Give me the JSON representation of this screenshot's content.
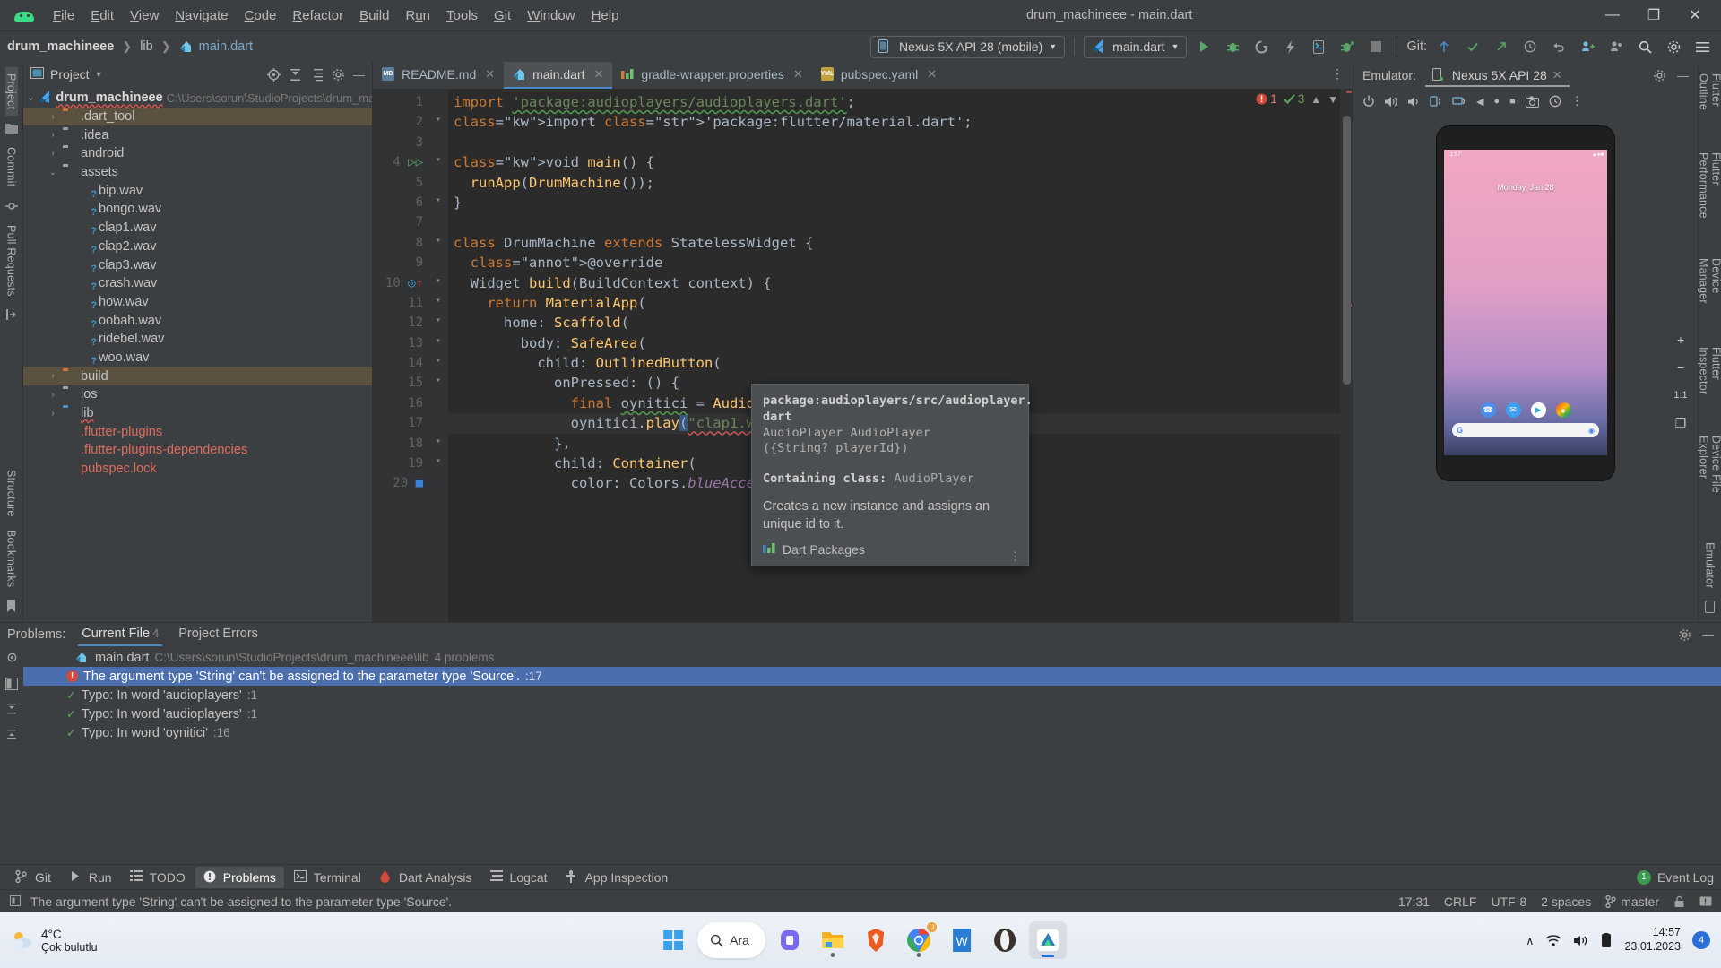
{
  "window": {
    "title": "drum_machineee - main.dart"
  },
  "menu": {
    "items": [
      "File",
      "Edit",
      "View",
      "Navigate",
      "Code",
      "Refactor",
      "Build",
      "Run",
      "Tools",
      "Git",
      "Window",
      "Help"
    ]
  },
  "window_controls": {
    "minimize": "—",
    "maximize": "❐",
    "close": "✕"
  },
  "breadcrumb": {
    "project": "drum_machineee",
    "folder": "lib",
    "file": "main.dart"
  },
  "toolbar": {
    "device_selector": "Nexus 5X API 28 (mobile)",
    "run_config": "main.dart",
    "git_label": "Git:",
    "run_title": "Run",
    "debug_title": "Debug",
    "profile_title": "Profile",
    "hot_reload_title": "Hot Reload",
    "open_devtools_title": "Open DevTools",
    "flutter_inspector_title": "Flutter Inspector",
    "stop_title": "Stop",
    "search_title": "Search Everywhere",
    "settings_title": "Settings"
  },
  "left_rail": {
    "items": [
      "Project",
      "Commit",
      "Pull Requests"
    ]
  },
  "right_rail": {
    "items": [
      "Flutter Outline",
      "Flutter Performance",
      "Device Manager",
      "Flutter Inspector",
      "Device File Explorer",
      "Emulator"
    ]
  },
  "bottom_rail": {
    "items": [
      "Structure",
      "Bookmarks"
    ]
  },
  "project_panel": {
    "title": "Project",
    "root": {
      "label": "drum_machineee",
      "path": "C:\\Users\\sorun\\StudioProjects\\drum_machine"
    },
    "tree": [
      {
        "label": ".dart_tool",
        "type": "folder-orange",
        "depth": 1,
        "arrow": "›",
        "highlight": true
      },
      {
        "label": ".idea",
        "type": "folder-idea",
        "depth": 1,
        "arrow": "›"
      },
      {
        "label": "android",
        "type": "folder-android",
        "depth": 1,
        "arrow": "›"
      },
      {
        "label": "assets",
        "type": "folder",
        "depth": 1,
        "arrow": "⌄",
        "expanded": true
      },
      {
        "label": "bip.wav",
        "type": "file-unknown",
        "depth": 2
      },
      {
        "label": "bongo.wav",
        "type": "file-unknown",
        "depth": 2
      },
      {
        "label": "clap1.wav",
        "type": "file-unknown",
        "depth": 2
      },
      {
        "label": "clap2.wav",
        "type": "file-unknown",
        "depth": 2
      },
      {
        "label": "clap3.wav",
        "type": "file-unknown",
        "depth": 2
      },
      {
        "label": "crash.wav",
        "type": "file-unknown",
        "depth": 2
      },
      {
        "label": "how.wav",
        "type": "file-unknown",
        "depth": 2
      },
      {
        "label": "oobah.wav",
        "type": "file-unknown",
        "depth": 2
      },
      {
        "label": "ridebel.wav",
        "type": "file-unknown",
        "depth": 2
      },
      {
        "label": "woo.wav",
        "type": "file-unknown",
        "depth": 2
      },
      {
        "label": "build",
        "type": "folder-build",
        "depth": 1,
        "arrow": "›",
        "highlight": true
      },
      {
        "label": "ios",
        "type": "folder",
        "depth": 1,
        "arrow": "›"
      },
      {
        "label": "lib",
        "type": "folder-blue",
        "depth": 1,
        "arrow": "›",
        "squiggle": true
      },
      {
        "label": ".flutter-plugins",
        "type": "file-text",
        "depth": 1,
        "red": true
      },
      {
        "label": ".flutter-plugins-dependencies",
        "type": "file-text",
        "depth": 1,
        "red": true
      },
      {
        "label": "pubspec.lock",
        "type": "file-yml",
        "depth": 1,
        "red": true
      }
    ]
  },
  "editor": {
    "tabs": [
      {
        "label": "README.md",
        "icon": "MD",
        "icon_color": "#5f7d9a",
        "active": false
      },
      {
        "label": "main.dart",
        "icon": "dart",
        "icon_color": "#3cb4e5",
        "active": true
      },
      {
        "label": "gradle-wrapper.properties",
        "icon": "chart",
        "icon_color": "#d07a34",
        "active": false
      },
      {
        "label": "pubspec.yaml",
        "icon": "YML",
        "icon_color": "#c4a23b",
        "active": false
      }
    ],
    "inspection": {
      "errors": "1",
      "warnings": "3"
    },
    "first_line_number": 1,
    "lines": [
      {
        "n": 1,
        "text": "import 'package:audioplayers/audioplayers.dart';"
      },
      {
        "n": 2,
        "text": "import 'package:flutter/material.dart';"
      },
      {
        "n": 3,
        "text": ""
      },
      {
        "n": 4,
        "text": "void main() {"
      },
      {
        "n": 5,
        "text": "  runApp(DrumMachine());"
      },
      {
        "n": 6,
        "text": "}"
      },
      {
        "n": 7,
        "text": ""
      },
      {
        "n": 8,
        "text": "class DrumMachine extends StatelessWidget {"
      },
      {
        "n": 9,
        "text": "  @override"
      },
      {
        "n": 10,
        "text": "  Widget build(BuildContext context) {"
      },
      {
        "n": 11,
        "text": "    return MaterialApp("
      },
      {
        "n": 12,
        "text": "      home: Scaffold("
      },
      {
        "n": 13,
        "text": "        body: SafeArea("
      },
      {
        "n": 14,
        "text": "          child: OutlinedButton("
      },
      {
        "n": 15,
        "text": "            onPressed: () {"
      },
      {
        "n": 16,
        "text": "              final oynitici = AudioPlayer();"
      },
      {
        "n": 17,
        "text": "              oynitici.play(\"clap1.wav\");"
      },
      {
        "n": 18,
        "text": "            },"
      },
      {
        "n": 19,
        "text": "            child: Container("
      },
      {
        "n": 20,
        "text": "              color: Colors.blueAccent."
      }
    ]
  },
  "doc_popup": {
    "signature_line1": "package:audioplayers/src/audioplayer.",
    "signature_line2": "dart",
    "signature_line3": "AudioPlayer AudioPlayer",
    "signature_line4": "({String? playerId})",
    "containing_label": "Containing class:",
    "containing_value": "AudioPlayer",
    "description": "Creates a new instance and assigns an unique id to it.",
    "source": "Dart Packages",
    "kebab": "⋮"
  },
  "emulator": {
    "label": "Emulator:",
    "tab": "Nexus 5X API 28",
    "toolbar_icons": [
      "power-icon",
      "volume-up-icon",
      "volume-down-icon",
      "rotate-left-icon",
      "rotate-right-icon",
      "back-icon",
      "home-icon",
      "overview-icon",
      "screenshot-icon",
      "history-icon",
      "more-icon"
    ],
    "side_buttons": [
      "+",
      "−",
      "1:1",
      "❐"
    ],
    "device": {
      "status_time": "11:57",
      "date_widget": "Monday, Jan 28",
      "dock_apps": [
        "phone-icon",
        "messages-icon",
        "play-store-icon",
        "chrome-icon"
      ],
      "search_placeholder": "",
      "nav_back": "◀",
      "nav_home": "●",
      "nav_recent": "■"
    }
  },
  "problems": {
    "label": "Problems:",
    "tabs": [
      {
        "label": "Current File",
        "count": "4",
        "active": true
      },
      {
        "label": "Project Errors",
        "count": "",
        "active": false
      }
    ],
    "file": {
      "name": "main.dart",
      "path": "C:\\Users\\sorun\\StudioProjects\\drum_machineee\\lib",
      "count": "4 problems"
    },
    "items": [
      {
        "severity": "error",
        "text": "The argument type 'String' can't be assigned to the parameter type 'Source'.",
        "line": ":17",
        "selected": true
      },
      {
        "severity": "typo",
        "text": "Typo: In word 'audioplayers'",
        "line": ":1",
        "selected": false
      },
      {
        "severity": "typo",
        "text": "Typo: In word 'audioplayers'",
        "line": ":1",
        "selected": false
      },
      {
        "severity": "typo",
        "text": "Typo: In word 'oynitici'",
        "line": ":16",
        "selected": false
      }
    ]
  },
  "tool_windows": {
    "items": [
      {
        "label": "Git",
        "icon": "branch-icon",
        "active": false
      },
      {
        "label": "Run",
        "icon": "play-icon",
        "active": false
      },
      {
        "label": "TODO",
        "icon": "list-icon",
        "active": false
      },
      {
        "label": "Problems",
        "icon": "error-icon",
        "active": true
      },
      {
        "label": "Terminal",
        "icon": "terminal-icon",
        "active": false
      },
      {
        "label": "Dart Analysis",
        "icon": "dart-icon",
        "active": false
      },
      {
        "label": "Logcat",
        "icon": "logcat-icon",
        "active": false
      },
      {
        "label": "App Inspection",
        "icon": "inspection-icon",
        "active": false
      }
    ],
    "event_log": {
      "label": "Event Log",
      "count": "1"
    }
  },
  "status_bar": {
    "message": "The argument type 'String' can't be assigned to the parameter type 'Source'.",
    "position": "17:31",
    "line_sep": "CRLF",
    "encoding": "UTF-8",
    "indent": "2 spaces",
    "branch": "master"
  },
  "taskbar": {
    "weather": {
      "temp": "4°C",
      "desc": "Çok bulutlu"
    },
    "search_label": "Ara",
    "apps": [
      "start-icon",
      "search-box",
      "teams-icon",
      "file-explorer-icon",
      "brave-icon",
      "chrome-icon",
      "word-icon",
      "opera-icon",
      "android-studio-icon"
    ],
    "tray": {
      "chevron": "∧",
      "wifi": "wifi-icon",
      "volume": "volume-icon",
      "battery": "battery-icon"
    },
    "clock": {
      "time": "14:57",
      "date": "23.01.2023"
    },
    "notification_count": "4"
  },
  "colors": {
    "accent": "#4a88c7",
    "error": "#d0493b",
    "selection": "#4b6eaf",
    "flutter": "#3cb4e5",
    "android_green": "#3ddc84"
  }
}
